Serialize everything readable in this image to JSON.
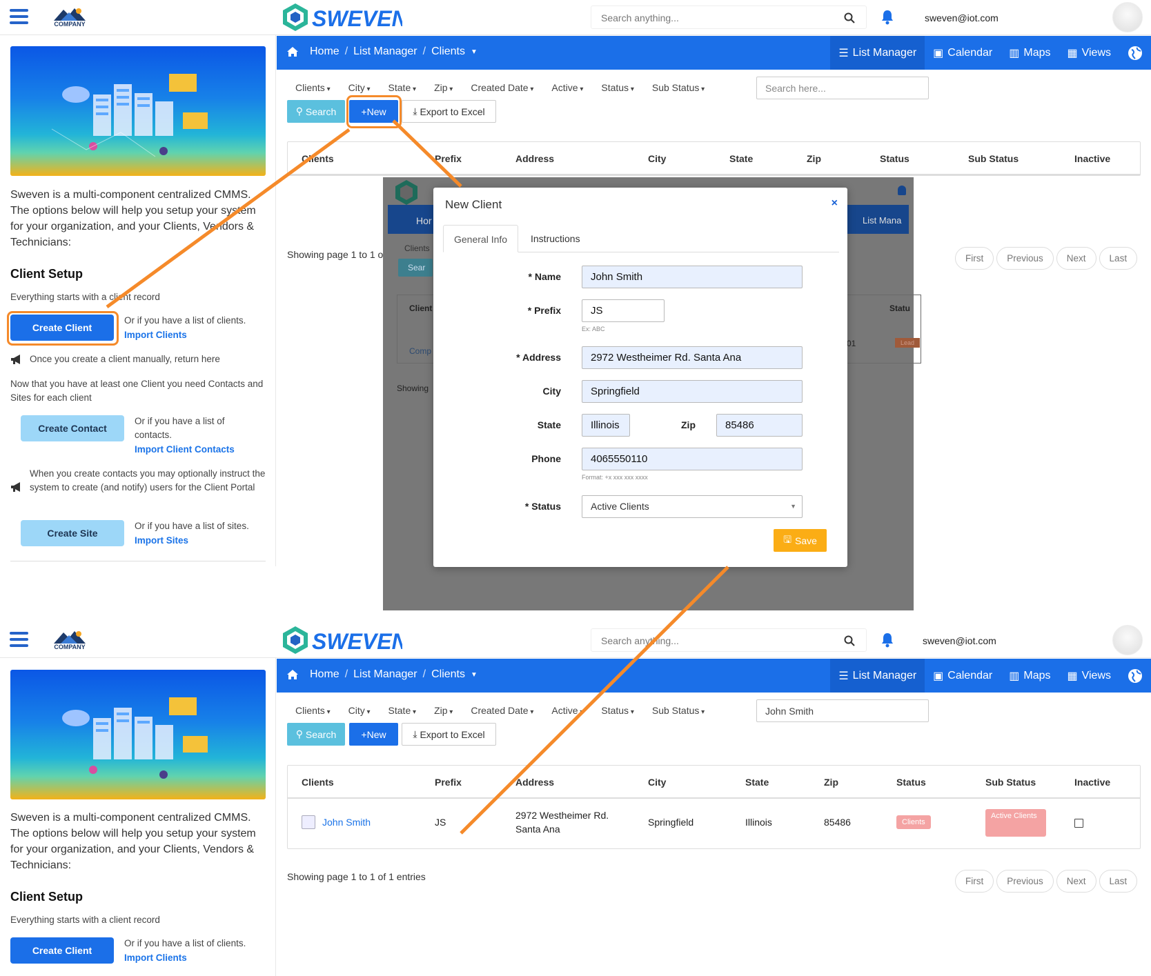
{
  "header": {
    "company_logo_text": "COMPANY NAME",
    "app_logo_text": "SWEVEN",
    "search_placeholder": "Search anything...",
    "user_email": "sweven@iot.com"
  },
  "sidebar": {
    "description": "Sweven is a multi-component centralized CMMS. The options below will help you setup your system for your organization, and your Clients, Vendors & Technicians:",
    "setup_title": "Client Setup",
    "setup_subtitle": "Everything starts with a client record",
    "create_client": "Create Client",
    "clients_list_text": "Or if you have a list of clients.",
    "import_clients": "Import Clients",
    "return_note": "Once you create a client manually, return here",
    "contacts_note": "Now that you have at least one Client you need Contacts and Sites for  each client",
    "create_contact": "Create Contact",
    "contacts_list_text": "Or if you have a list of contacts.",
    "import_contacts": "Import Client Contacts",
    "portal_note": "When you create contacts you may optionally instruct the system to create (and notify) users for the Client Portal",
    "create_site": "Create Site",
    "sites_list_text": "Or if you have a list of sites.",
    "import_sites": "Import Sites"
  },
  "nav": {
    "breadcrumbs": [
      "Home",
      "List Manager",
      "Clients"
    ],
    "right": [
      "List Manager",
      "Calendar",
      "Maps",
      "Views"
    ]
  },
  "filters": [
    "Clients",
    "City",
    "State",
    "Zip",
    "Created Date",
    "Active",
    "Status",
    "Sub Status"
  ],
  "toolbar": {
    "search": "Search",
    "new": "New",
    "export": "Export to Excel",
    "filter_placeholder": "Search here...",
    "filter_value": "John Smith"
  },
  "table": {
    "columns_top": [
      "Clients",
      "Prefix",
      "Address",
      "City",
      "State",
      "Zip",
      "Status",
      "Sub Status",
      "Inactive"
    ],
    "row": {
      "client": "John Smith",
      "prefix": "JS",
      "address_1": "2972 Westheimer Rd.",
      "address_2": "Santa Ana",
      "city": "Springfield",
      "state": "Illinois",
      "zip": "85486",
      "status": "Clients",
      "sub_status": "Active Clients"
    }
  },
  "showing_top": "Showing page 1 to 1 o",
  "showing_bottom": "Showing page 1 to 1 of 1 entries",
  "pager": [
    "First",
    "Previous",
    "Next",
    "Last"
  ],
  "modal": {
    "title": "New Client",
    "close": "×",
    "tabs": [
      "General Info",
      "Instructions"
    ],
    "labels": {
      "name": "* Name",
      "prefix": "* Prefix",
      "address": "* Address",
      "city": "City",
      "state": "State",
      "zip": "Zip",
      "phone": "Phone",
      "status": "* Status"
    },
    "values": {
      "name": "John Smith",
      "prefix": "JS",
      "address": "2972 Westheimer Rd. Santa Ana",
      "city": "Springfield",
      "state": "Illinois",
      "zip": "85486",
      "phone": "4065550110",
      "status": "Active Clients"
    },
    "hints": {
      "prefix": "Ex: ABC",
      "phone": "Format: +x xxx xxx xxxx"
    },
    "save": "Save"
  },
  "ghost": {
    "home": "Hor",
    "list": "List Mana",
    "clients": "Clients",
    "search": "Sear",
    "client_col": "Client",
    "status_col": "Statu",
    "comp": "Comp",
    "showing": "Showing",
    "num": "01",
    "badge": "Lead"
  },
  "colors": {
    "primary": "#1b6fe8",
    "accent_orange": "#f58a2a",
    "save": "#fbad15",
    "info": "#5bc0de"
  }
}
